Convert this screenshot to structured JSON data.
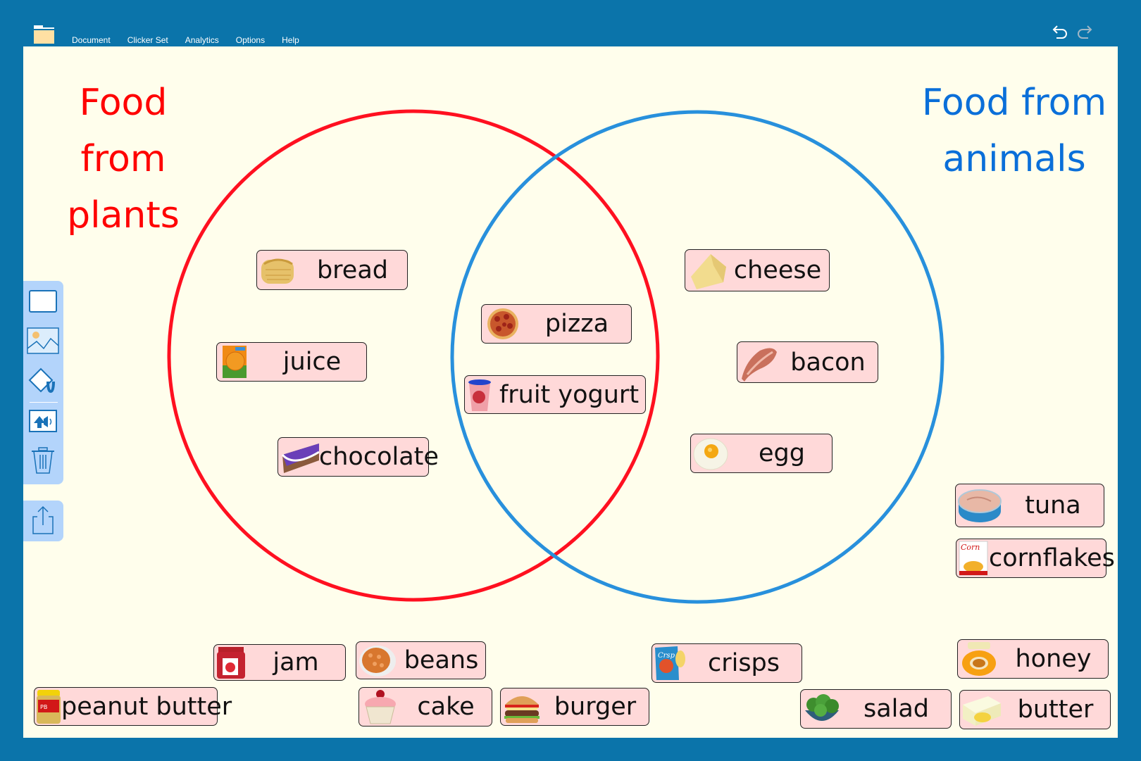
{
  "app": {
    "menu": [
      "Document",
      "Clicker Set",
      "Analytics",
      "Options",
      "Help"
    ],
    "icons": {
      "folder": "folder-icon",
      "undo": "undo-icon",
      "redo": "redo-icon"
    }
  },
  "colors": {
    "frame": "#0b74aa",
    "canvas": "#fffeec",
    "plants": "#ff0000",
    "animals": "#0a6fd9",
    "plants_circle": "#ff1020",
    "animals_circle": "#2890dc",
    "card": "#ffd9d9",
    "toolbar": "#b3d4fb"
  },
  "venn": {
    "left_title": "Food from plants",
    "left_title_lines": [
      "Food from",
      "plants"
    ],
    "right_title": "Food from animals",
    "right_title_lines": [
      "Food from",
      "animals"
    ]
  },
  "toolbar": {
    "tools": [
      "rectangle-tool",
      "image-tool",
      "fill-tool",
      "speech-tool",
      "delete-tool"
    ],
    "export": "export-tool"
  },
  "cards": [
    {
      "label": "bread",
      "icon": "bread",
      "zone": "plants"
    },
    {
      "label": "juice",
      "icon": "juice",
      "zone": "plants"
    },
    {
      "label": "chocolate",
      "icon": "chocolate",
      "zone": "plants"
    },
    {
      "label": "pizza",
      "icon": "pizza",
      "zone": "both"
    },
    {
      "label": "fruit yogurt",
      "icon": "yogurt",
      "zone": "both"
    },
    {
      "label": "cheese",
      "icon": "cheese",
      "zone": "animals"
    },
    {
      "label": "bacon",
      "icon": "bacon",
      "zone": "animals"
    },
    {
      "label": "egg",
      "icon": "egg",
      "zone": "animals"
    },
    {
      "label": "tuna",
      "icon": "tuna",
      "zone": "unsorted"
    },
    {
      "label": "cornflakes",
      "icon": "cornflakes",
      "zone": "unsorted"
    },
    {
      "label": "jam",
      "icon": "jam",
      "zone": "unsorted"
    },
    {
      "label": "beans",
      "icon": "beans",
      "zone": "unsorted"
    },
    {
      "label": "crisps",
      "icon": "crisps",
      "zone": "unsorted"
    },
    {
      "label": "honey",
      "icon": "honey",
      "zone": "unsorted"
    },
    {
      "label": "peanut butter",
      "icon": "peanut-butter",
      "zone": "unsorted"
    },
    {
      "label": "cake",
      "icon": "cake",
      "zone": "unsorted"
    },
    {
      "label": "burger",
      "icon": "burger",
      "zone": "unsorted"
    },
    {
      "label": "salad",
      "icon": "salad",
      "zone": "unsorted"
    },
    {
      "label": "butter",
      "icon": "butter",
      "zone": "unsorted"
    }
  ]
}
